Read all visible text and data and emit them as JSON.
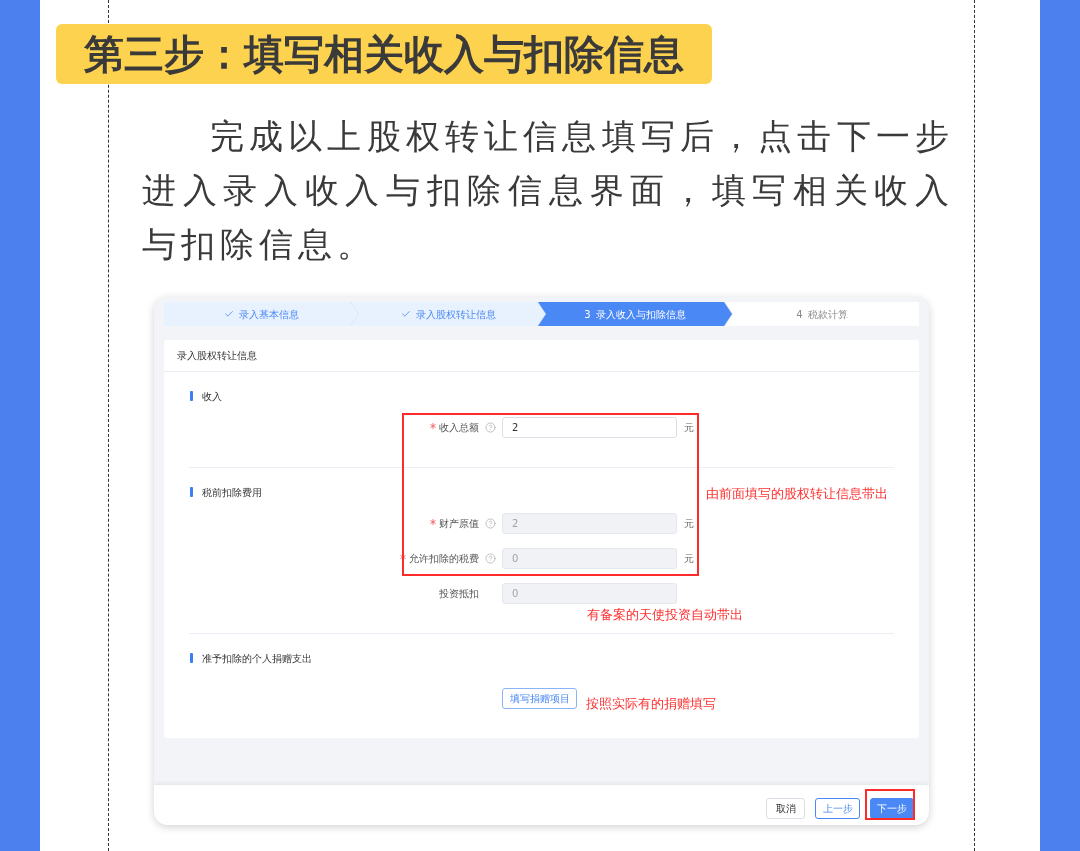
{
  "title": "第三步：填写相关收入与扣除信息",
  "intro": "完成以上股权转让信息填写后，点击下一步进入录入收入与扣除信息界面，填写相关收入与扣除信息。",
  "screenshot": {
    "steps": [
      {
        "label": "录入基本信息",
        "completed": true,
        "selected": false
      },
      {
        "label": "录入股权转让信息",
        "completed": true,
        "selected": false
      },
      {
        "number": "3",
        "label": "录入收入与扣除信息",
        "completed": false,
        "selected": true
      },
      {
        "number": "4",
        "label": "税款计算",
        "completed": false,
        "selected": false
      }
    ],
    "card_title": "录入股权转让信息",
    "sections": [
      {
        "title": "收入",
        "fields": [
          {
            "label": "收入总额",
            "required": true,
            "help": true,
            "value": "2",
            "unit": "元",
            "disabled": false
          }
        ]
      },
      {
        "title": "税前扣除费用",
        "fields": [
          {
            "label": "财产原值",
            "required": true,
            "help": true,
            "value": "2",
            "unit": "元",
            "disabled": true
          },
          {
            "label": "允许扣除的税费",
            "required": true,
            "help": true,
            "value": "0",
            "unit": "元",
            "disabled": true
          },
          {
            "label": "投资抵扣",
            "required": false,
            "help": false,
            "value": "0",
            "disabled": true
          }
        ]
      },
      {
        "title": "准予扣除的个人捐赠支出",
        "action_button": "填写捐赠项目"
      }
    ],
    "footer_buttons": [
      {
        "label": "取消",
        "kind": "default"
      },
      {
        "label": "上一步",
        "kind": "outline"
      },
      {
        "label": "下一步",
        "kind": "primary"
      }
    ]
  },
  "annotations": [
    "由前面填写的股权转让信息带出",
    "有备案的天使投资自动带出",
    "按照实际有的捐赠填写"
  ]
}
